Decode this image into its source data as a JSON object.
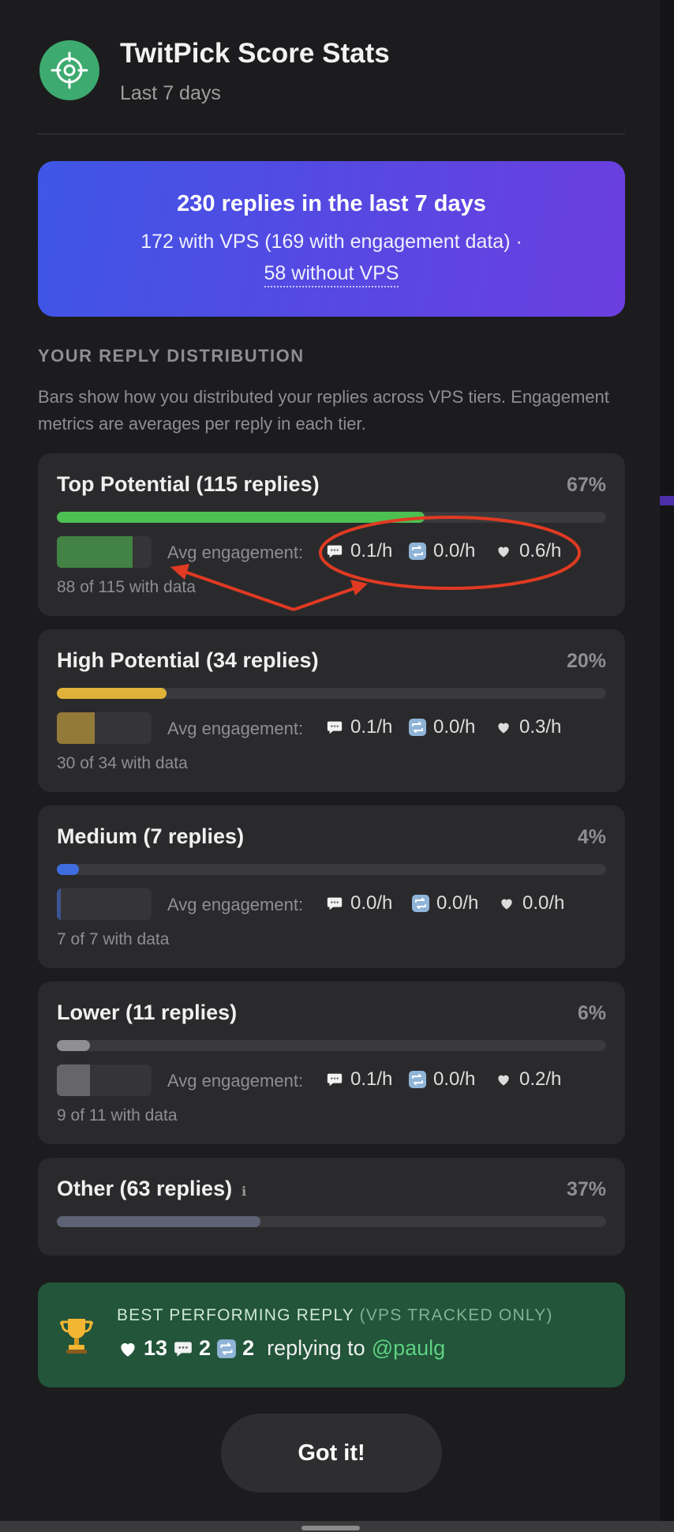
{
  "header": {
    "title": "TwitPick Score Stats",
    "subtitle": "Last 7 days",
    "logo_icon": "target-icon",
    "logo_color": "#3daa6f"
  },
  "summary": {
    "main": "230 replies in the last 7 days",
    "sub_line1": "172 with VPS (169 with engagement data) ·",
    "sub_line2": "58 without VPS"
  },
  "distribution": {
    "heading": "YOUR REPLY DISTRIBUTION",
    "description": "Bars show how you distributed your replies across VPS tiers. Engagement metrics are averages per reply in each tier.",
    "eng_label": "Avg engagement:",
    "tiers": [
      {
        "name": "Top Potential (115 replies)",
        "pct": "67%",
        "pct_value": 67,
        "color": "#4cc152",
        "mini_fraction": 0.8,
        "replies": "0.1/h",
        "retweets": "0.0/h",
        "likes": "0.6/h",
        "with_data": "88 of 115 with data"
      },
      {
        "name": "High Potential (34 replies)",
        "pct": "20%",
        "pct_value": 20,
        "color": "#e0b23a",
        "mini_fraction": 0.4,
        "replies": "0.1/h",
        "retweets": "0.0/h",
        "likes": "0.3/h",
        "with_data": "30 of 34 with data"
      },
      {
        "name": "Medium (7 replies)",
        "pct": "4%",
        "pct_value": 4,
        "color": "#3f6de0",
        "mini_fraction": 0.04,
        "replies": "0.0/h",
        "retweets": "0.0/h",
        "likes": "0.0/h",
        "with_data": "7 of 7 with data"
      },
      {
        "name": "Lower (11 replies)",
        "pct": "6%",
        "pct_value": 6,
        "color": "#8e8e93",
        "mini_fraction": 0.35,
        "replies": "0.1/h",
        "retweets": "0.0/h",
        "likes": "0.2/h",
        "with_data": "9 of 11 with data"
      },
      {
        "name": "Other (63 replies)",
        "pct": "37%",
        "pct_value": 37,
        "color": "#5d6275",
        "info_icon": "ℹ"
      }
    ]
  },
  "best": {
    "title": "BEST PERFORMING REPLY",
    "title_note": "(VPS TRACKED ONLY)",
    "likes": "13",
    "replies": "2",
    "retweets": "2",
    "replying_to": "replying to",
    "handle": "@paulg"
  },
  "button": {
    "label": "Got it!"
  },
  "colors": {
    "accent_green": "#5ed183",
    "annotation_red": "#e03a22"
  }
}
